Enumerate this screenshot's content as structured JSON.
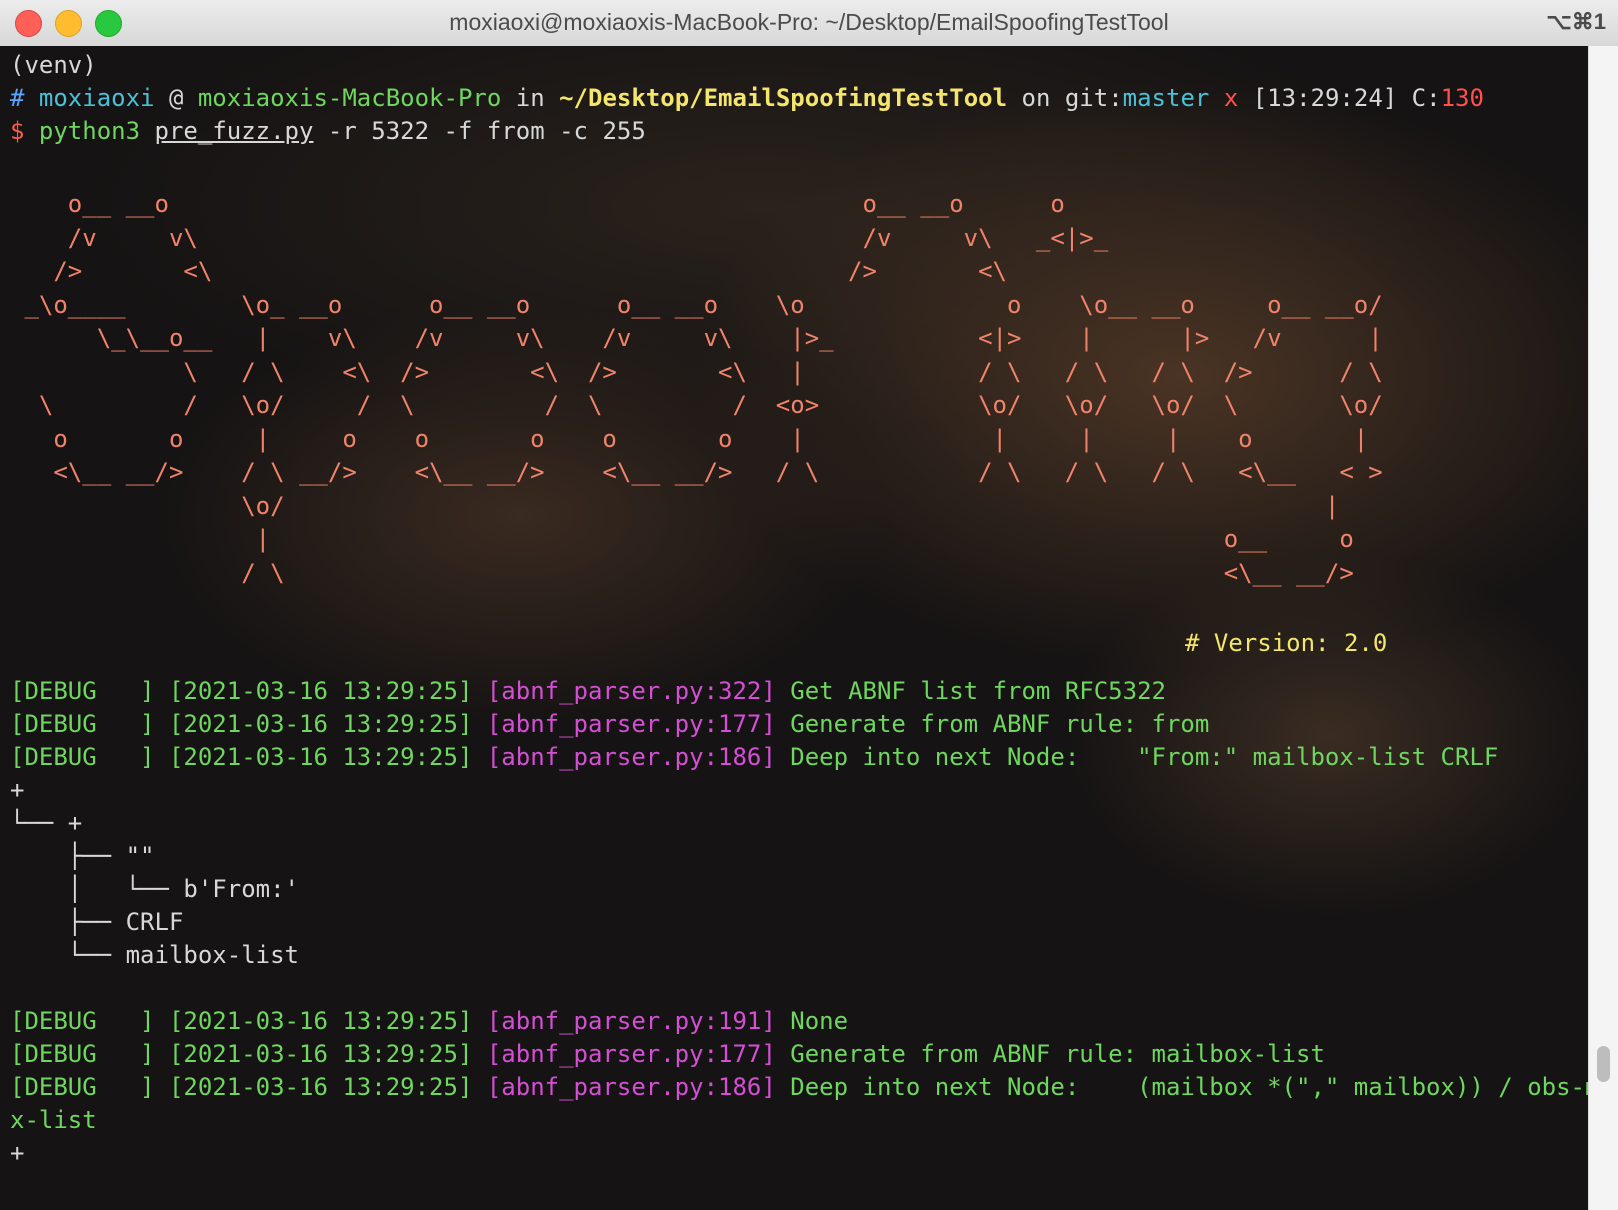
{
  "window": {
    "title": "moxiaoxi@moxiaoxis-MacBook-Pro: ~/Desktop/EmailSpoofingTestTool",
    "shortcut": "⌥⌘1"
  },
  "prompt": {
    "venv": "(venv)",
    "hash": "#",
    "user": "moxiaoxi",
    "at": "@",
    "host": "moxiaoxis-MacBook-Pro",
    "in": "in",
    "path": "~/Desktop/EmailSpoofingTestTool",
    "on": "on",
    "git": "git:",
    "branch": "master",
    "dirty": "x",
    "time": "[13:29:24]",
    "code_label": "C:",
    "code": "130",
    "symbol": "$",
    "command": "python3",
    "file": "pre_fuzz.py",
    "args": "-r 5322 -f from -c 255"
  },
  "banner": {
    "art": "    o__ __o                                                o__ __o      o\n    /v     v\\                                              /v     v\\   _<|>_\n   />       <\\                                            />       <\\\n _\\o____        \\o_ __o      o__ __o      o__ __o    \\o              o    \\o__ __o     o__ __o/\n      \\_\\__o__   |    v\\    /v     v\\    /v     v\\    |>_          <|>    |      |>   /v      |\n            \\   / \\    <\\  />       <\\  />       <\\   |            / \\   / \\   / \\  />      / \\\n  \\         /   \\o/     /  \\         /  \\         /  <o>           \\o/   \\o/   \\o/  \\       \\o/\n   o       o     |     o    o       o    o       o    |             |     |     |    o       |\n   <\\__ __/>    / \\ __/>    <\\__ __/>    <\\__ __/>   / \\           / \\   / \\   / \\   <\\__   < >\n                \\o/                                                                        |\n                 |                                                                  o__     o\n                / \\                                                                 <\\__ __/>",
    "version": "# Version: 2.0"
  },
  "logs": [
    {
      "level": "[DEBUG   ]",
      "time": "[2021-03-16 13:29:25]",
      "src": "[abnf_parser.py:322]",
      "msg": "Get ABNF list from RFC5322"
    },
    {
      "level": "[DEBUG   ]",
      "time": "[2021-03-16 13:29:25]",
      "src": "[abnf_parser.py:177]",
      "msg": "Generate from ABNF rule: from"
    },
    {
      "level": "[DEBUG   ]",
      "time": "[2021-03-16 13:29:25]",
      "src": "[abnf_parser.py:186]",
      "msg": "Deep into next Node:    \"From:\" mailbox-list CRLF"
    },
    {
      "level": "[DEBUG   ]",
      "time": "[2021-03-16 13:29:25]",
      "src": "[abnf_parser.py:191]",
      "msg": "None"
    },
    {
      "level": "[DEBUG   ]",
      "time": "[2021-03-16 13:29:25]",
      "src": "[abnf_parser.py:177]",
      "msg": "Generate from ABNF rule: mailbox-list"
    },
    {
      "level": "[DEBUG   ]",
      "time": "[2021-03-16 13:29:25]",
      "src": "[abnf_parser.py:186]",
      "msg": "Deep into next Node:    (mailbox *(\",\" mailbox)) / obs-mbo"
    }
  ],
  "tree": [
    "+",
    "└── +",
    "    ├── \"\"",
    "    │   └── b'From:'",
    "    ├── CRLF",
    "    └── mailbox-list"
  ],
  "wrap": "x-list",
  "tail": "+"
}
